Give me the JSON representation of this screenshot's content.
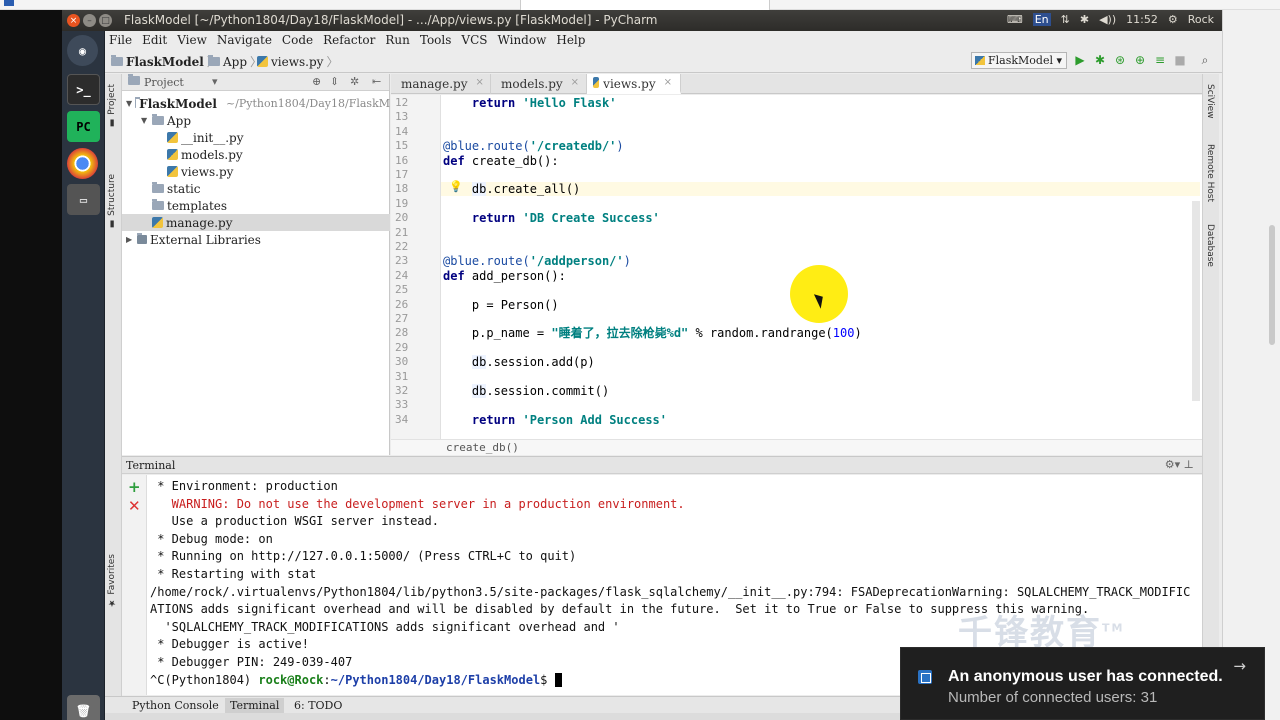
{
  "window": {
    "title": "FlaskModel [~/Python1804/Day18/FlaskModel] - .../App/views.py [FlaskModel] - PyCharm",
    "tray": {
      "input_method": "En",
      "clock": "11:52",
      "user": "Rock"
    }
  },
  "launcher": {
    "terminal_label": ">_",
    "pycharm_label": "PC"
  },
  "menu": {
    "items": [
      "File",
      "Edit",
      "View",
      "Navigate",
      "Code",
      "Refactor",
      "Run",
      "Tools",
      "VCS",
      "Window",
      "Help"
    ]
  },
  "navbar": {
    "crumbs": [
      "FlaskModel",
      "App",
      "views.py"
    ],
    "run_config": "FlaskModel"
  },
  "project": {
    "header": "Project",
    "tree": [
      {
        "label": "FlaskModel",
        "path": "~/Python1804/Day18/FlaskM",
        "indent": 0,
        "arrow": "▼",
        "kind": "folder"
      },
      {
        "label": "App",
        "indent": 1,
        "arrow": "▼",
        "kind": "folder"
      },
      {
        "label": "__init__.py",
        "indent": 2,
        "arrow": "",
        "kind": "py"
      },
      {
        "label": "models.py",
        "indent": 2,
        "arrow": "",
        "kind": "py"
      },
      {
        "label": "views.py",
        "indent": 2,
        "arrow": "",
        "kind": "py"
      },
      {
        "label": "static",
        "indent": 1,
        "arrow": "",
        "kind": "folder"
      },
      {
        "label": "templates",
        "indent": 1,
        "arrow": "",
        "kind": "folder"
      },
      {
        "label": "manage.py",
        "indent": 1,
        "arrow": "",
        "kind": "py",
        "selected": true
      },
      {
        "label": "External Libraries",
        "indent": 0,
        "arrow": "▶",
        "kind": "lib"
      }
    ]
  },
  "editor": {
    "tabs": [
      {
        "label": "manage.py",
        "active": false
      },
      {
        "label": "models.py",
        "active": false
      },
      {
        "label": "views.py",
        "active": true
      }
    ],
    "line_numbers": [
      "12",
      "13",
      "14",
      "15",
      "16",
      "17",
      "18",
      "19",
      "20",
      "21",
      "22",
      "23",
      "24",
      "25",
      "26",
      "27",
      "28",
      "29",
      "30",
      "31",
      "32",
      "33",
      "34"
    ],
    "lines": [
      {
        "n": "12",
        "parts": [
          {
            "t": "    "
          },
          {
            "t": "return",
            "c": "kw"
          },
          {
            "t": " "
          },
          {
            "t": "'Hello Flask'",
            "c": "st"
          }
        ]
      },
      {
        "n": "13",
        "parts": []
      },
      {
        "n": "14",
        "parts": []
      },
      {
        "n": "15",
        "parts": [
          {
            "t": "@blue.route(",
            "c": "dec"
          },
          {
            "t": "'/createdb/'",
            "c": "st"
          },
          {
            "t": ")",
            "c": "dec"
          }
        ]
      },
      {
        "n": "16",
        "parts": [
          {
            "t": "def",
            "c": "kw"
          },
          {
            "t": " create_db():"
          }
        ]
      },
      {
        "n": "17",
        "parts": []
      },
      {
        "n": "18",
        "parts": [
          {
            "t": "    "
          },
          {
            "t": "db",
            "c": "dbh"
          },
          {
            "t": ".create_all()"
          }
        ],
        "current": true
      },
      {
        "n": "19",
        "parts": []
      },
      {
        "n": "20",
        "parts": [
          {
            "t": "    "
          },
          {
            "t": "return",
            "c": "kw"
          },
          {
            "t": " "
          },
          {
            "t": "'DB Create Success'",
            "c": "st"
          }
        ]
      },
      {
        "n": "21",
        "parts": []
      },
      {
        "n": "22",
        "parts": []
      },
      {
        "n": "23",
        "parts": [
          {
            "t": "@blue.route(",
            "c": "dec"
          },
          {
            "t": "'/addperson/'",
            "c": "st"
          },
          {
            "t": ")",
            "c": "dec"
          }
        ]
      },
      {
        "n": "24",
        "parts": [
          {
            "t": "def",
            "c": "kw"
          },
          {
            "t": " add_person():"
          }
        ]
      },
      {
        "n": "25",
        "parts": []
      },
      {
        "n": "26",
        "parts": [
          {
            "t": "    p = Person()"
          }
        ]
      },
      {
        "n": "27",
        "parts": []
      },
      {
        "n": "28",
        "parts": [
          {
            "t": "    p.p_name = "
          },
          {
            "t": "\"睡着了，拉去除枪毙%d\"",
            "c": "st"
          },
          {
            "t": " % random.randrange("
          },
          {
            "t": "100",
            "c": "num"
          },
          {
            "t": ")"
          }
        ]
      },
      {
        "n": "29",
        "parts": []
      },
      {
        "n": "30",
        "parts": [
          {
            "t": "    "
          },
          {
            "t": "db",
            "c": "dbh"
          },
          {
            "t": ".session.add(p)"
          }
        ]
      },
      {
        "n": "31",
        "parts": []
      },
      {
        "n": "32",
        "parts": [
          {
            "t": "    "
          },
          {
            "t": "db",
            "c": "dbh"
          },
          {
            "t": ".session.commit()"
          }
        ]
      },
      {
        "n": "33",
        "parts": []
      },
      {
        "n": "34",
        "parts": [
          {
            "t": "    "
          },
          {
            "t": "return",
            "c": "kw"
          },
          {
            "t": " "
          },
          {
            "t": "'Person Add Success'",
            "c": "st"
          }
        ]
      }
    ],
    "breadcrumb": "create_db()"
  },
  "terminal": {
    "header": "Terminal",
    "lines": [
      {
        "t": " * Environment: production"
      },
      {
        "t": "   WARNING: Do not use the development server in a production environment.",
        "warn": true
      },
      {
        "t": "   Use a production WSGI server instead."
      },
      {
        "t": " * Debug mode: on"
      },
      {
        "t": " * Running on http://127.0.0.1:5000/ (Press CTRL+C to quit)"
      },
      {
        "t": " * Restarting with stat"
      },
      {
        "t": "/home/rock/.virtualenvs/Python1804/lib/python3.5/site-packages/flask_sqlalchemy/__init__.py:794: FSADeprecationWarning: SQLALCHEMY_TRACK_MODIFIC"
      },
      {
        "t": "ATIONS adds significant overhead and will be disabled by default in the future.  Set it to True or False to suppress this warning."
      },
      {
        "t": "  'SQLALCHEMY_TRACK_MODIFICATIONS adds significant overhead and '"
      },
      {
        "t": " * Debugger is active!"
      },
      {
        "t": " * Debugger PIN: 249-039-407"
      }
    ],
    "prompt": {
      "prefix": "^C(Python1804) ",
      "user_host": "rock@Rock",
      "sep": ":",
      "path": "~/Python1804/Day18/FlaskModel",
      "suffix": "$ "
    }
  },
  "bottom_tabs": [
    {
      "label": "Python Console",
      "active": false
    },
    {
      "label": "Terminal",
      "active": true
    },
    {
      "label": "6: TODO",
      "active": false
    }
  ],
  "watermark": {
    "text": "千锋教育",
    "tm": "TM"
  },
  "notification": {
    "title": "An anonymous user has connected.",
    "body": "Number of connected users: 31"
  }
}
